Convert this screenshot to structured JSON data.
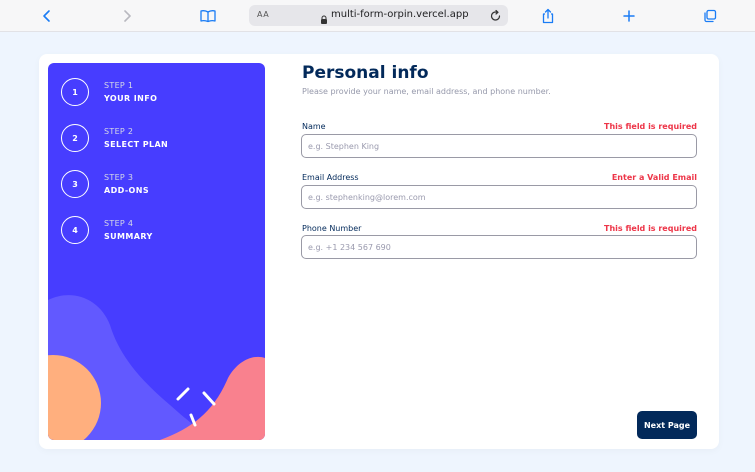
{
  "browser": {
    "reader_label": "AA",
    "url": "multi-form-orpin.vercel.app",
    "icons": [
      "chevron-left-icon",
      "chevron-right-icon",
      "book-icon",
      "lock-icon",
      "reload-icon",
      "share-icon",
      "plus-icon",
      "tabs-icon"
    ],
    "accent": "#1a7cf5"
  },
  "sidebar": {
    "background": "#473dff",
    "steps": [
      {
        "number": "1",
        "label": "STEP 1",
        "name": "YOUR INFO"
      },
      {
        "number": "2",
        "label": "STEP 2",
        "name": "SELECT PLAN"
      },
      {
        "number": "3",
        "label": "STEP 3",
        "name": "ADD-ONS"
      },
      {
        "number": "4",
        "label": "STEP 4",
        "name": "SUMMARY"
      }
    ]
  },
  "form": {
    "title": "Personal info",
    "subtitle": "Please provide your name, email address, and phone number.",
    "fields": [
      {
        "label": "Name",
        "error": "This field is required",
        "placeholder": "e.g. Stephen King",
        "value": ""
      },
      {
        "label": "Email Address",
        "error": "Enter a Valid Email",
        "placeholder": "e.g. stephenking@lorem.com",
        "value": ""
      },
      {
        "label": "Phone Number",
        "error": "This field is required",
        "placeholder": "e.g. +1 234 567 690",
        "value": ""
      }
    ],
    "next_label": "Next Page",
    "colors": {
      "title": "#02295a",
      "error": "#ed3548",
      "button": "#02295a"
    }
  }
}
